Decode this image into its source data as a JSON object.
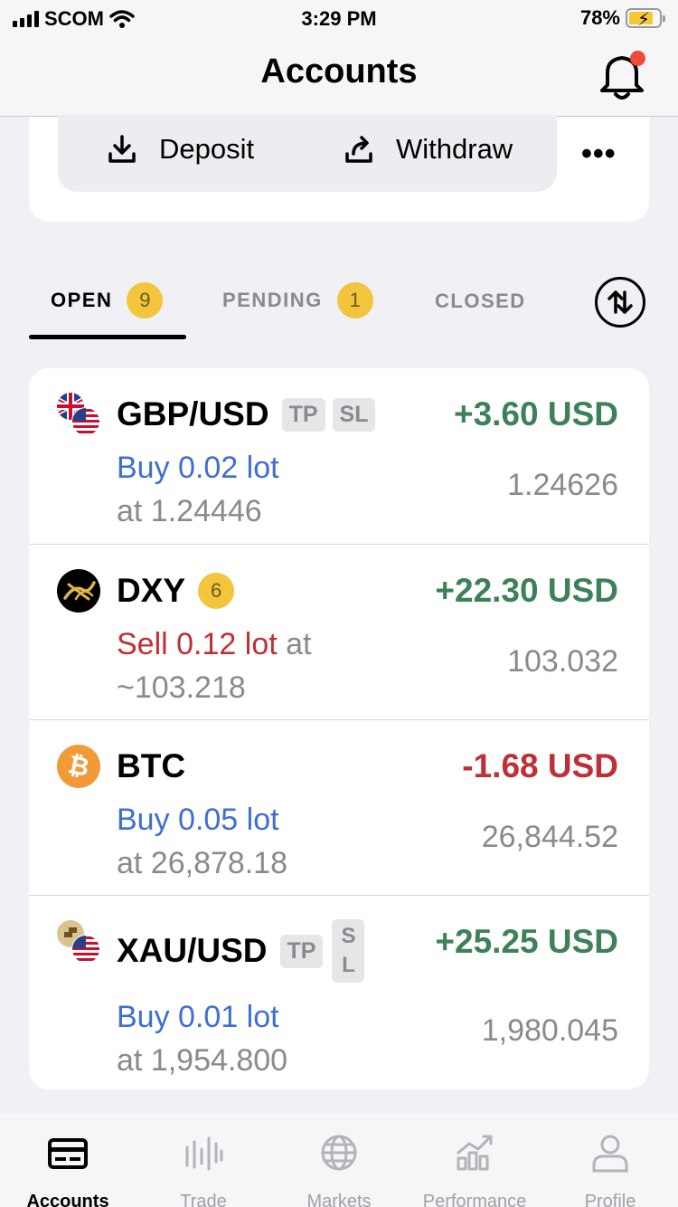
{
  "status_bar": {
    "carrier": "SCOM",
    "time": "3:29 PM",
    "battery": "78%"
  },
  "header": {
    "title": "Accounts"
  },
  "actions": {
    "deposit": "Deposit",
    "withdraw": "Withdraw",
    "more": "•••"
  },
  "tabs": [
    {
      "label": "OPEN",
      "count": "9"
    },
    {
      "label": "PENDING",
      "count": "1"
    },
    {
      "label": "CLOSED"
    }
  ],
  "positions": [
    {
      "symbol": "GBP/USD",
      "tags": [
        "TP",
        "SL"
      ],
      "pnl": "+3.60 USD",
      "side_text": "Buy 0.02 lot",
      "at_text": "at 1.24446",
      "current_price": "1.24626"
    },
    {
      "symbol": "DXY",
      "badge": "6",
      "pnl": "+22.30 USD",
      "side_text": "Sell 0.12 lot",
      "at_inline": " at",
      "at_text": "~103.218",
      "current_price": "103.032"
    },
    {
      "symbol": "BTC",
      "pnl": "-1.68 USD",
      "side_text": "Buy 0.05 lot",
      "at_text": "at 26,878.18",
      "current_price": "26,844.52"
    },
    {
      "symbol": "XAU/USD",
      "tags": [
        "TP"
      ],
      "stacked_tag": [
        "S",
        "L"
      ],
      "pnl": "+25.25 USD",
      "side_text": "Buy 0.01 lot",
      "at_text": "at 1,954.800",
      "current_price": "1,980.045"
    }
  ],
  "tabbar": [
    {
      "label": "Accounts",
      "icon": "card-icon"
    },
    {
      "label": "Trade",
      "icon": "candles-icon"
    },
    {
      "label": "Markets",
      "icon": "globe-icon"
    },
    {
      "label": "Performance",
      "icon": "chart-icon"
    },
    {
      "label": "Profile",
      "icon": "person-icon"
    }
  ],
  "colors": {
    "positive": "#3d8159",
    "negative": "#bf2f34",
    "buy": "#3f6fcf",
    "badge": "#f2c53d"
  }
}
